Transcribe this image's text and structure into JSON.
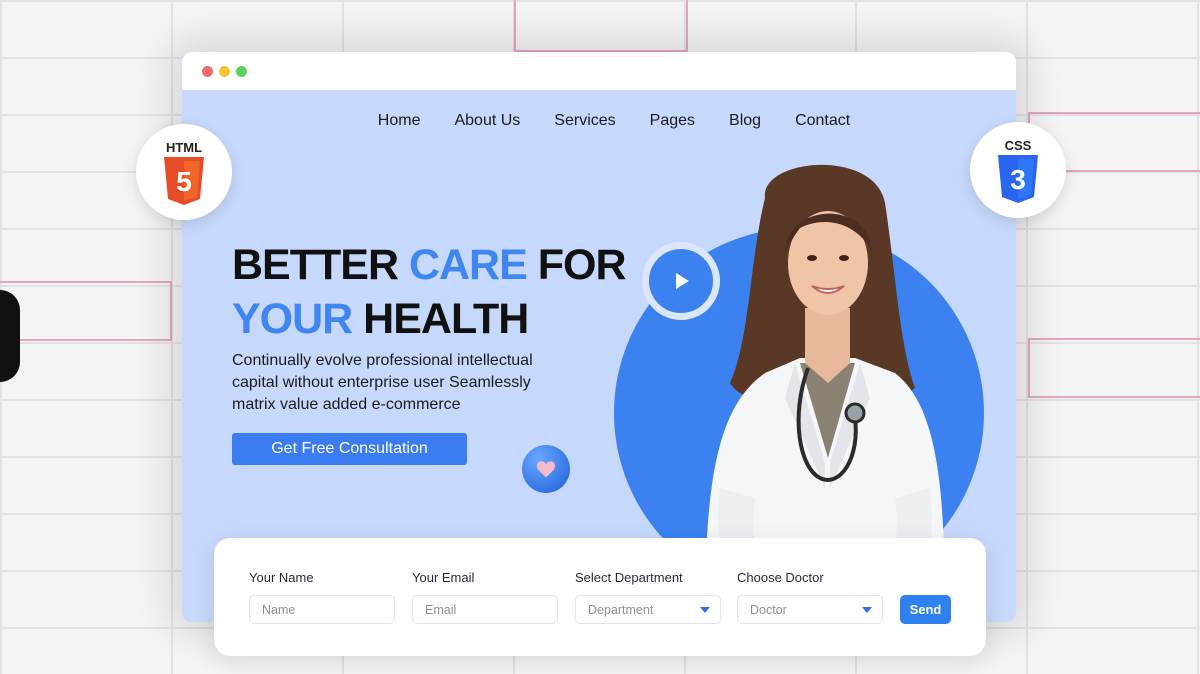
{
  "badges": {
    "html_label": "HTML",
    "html_number": "5",
    "css_label": "CSS",
    "css_number": "3"
  },
  "nav": {
    "items": [
      {
        "label": "Home"
      },
      {
        "label": "About Us"
      },
      {
        "label": "Services"
      },
      {
        "label": "Pages"
      },
      {
        "label": "Blog"
      },
      {
        "label": "Contact"
      }
    ]
  },
  "hero": {
    "title_line1_a": "BETTER ",
    "title_line1_b": "CARE",
    "title_line1_c": " FOR",
    "title_line2_a": "YOUR",
    "title_line2_b": " HEALTH",
    "description": "Continually evolve professional intellectual capital without enterprise user Seamlessly matrix value added e-commerce",
    "cta_label": "Get Free Consultation"
  },
  "form": {
    "name_label": "Your Name",
    "name_placeholder": "Name",
    "email_label": "Your Email",
    "email_placeholder": "Email",
    "department_label": "Select Department",
    "department_value": "Department",
    "doctor_label": "Choose Doctor",
    "doctor_value": "Doctor",
    "send_label": "Send"
  },
  "colors": {
    "accent": "#3b7df0",
    "hero_background": "#c6d8fb",
    "html_orange": "#e44d26",
    "css_blue": "#2965f1"
  }
}
